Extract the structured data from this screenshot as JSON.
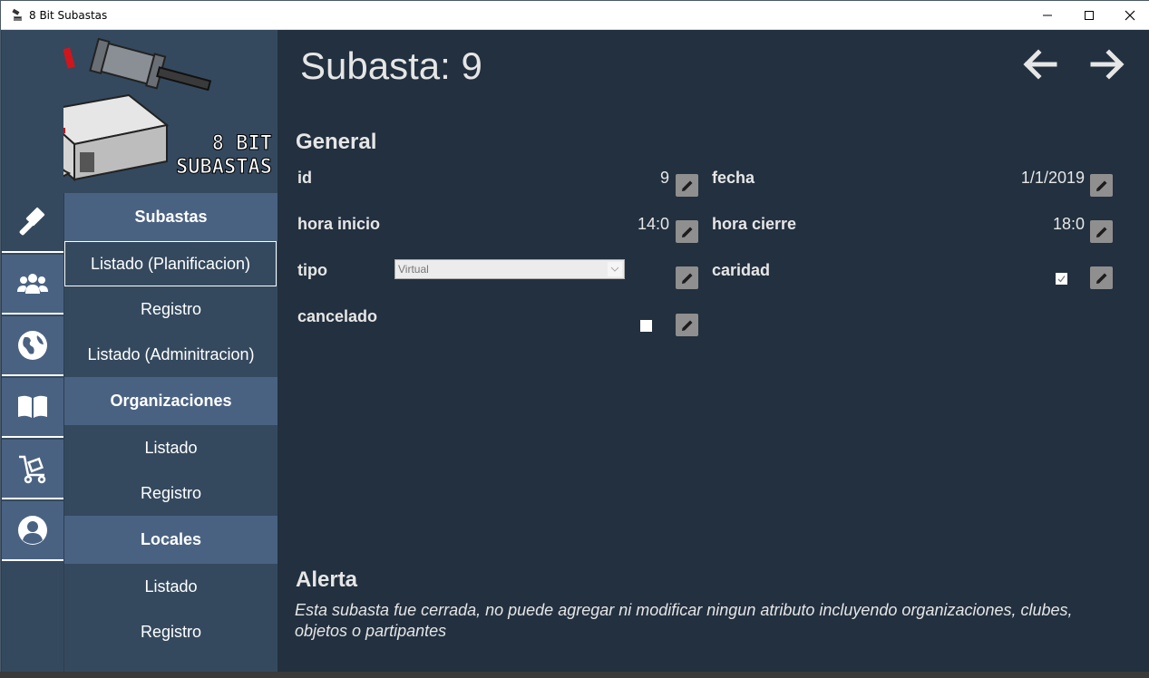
{
  "window": {
    "title": "8 Bit Subastas"
  },
  "logo": {
    "line1": "8 BIT",
    "line2": "SUBASTAS"
  },
  "nav_icons": [
    "gavel-icon",
    "users-icon",
    "globe-icon",
    "book-icon",
    "cart-icon",
    "user-circle-icon"
  ],
  "submenu": {
    "subastas_header": "Subastas",
    "subastas_items": [
      "Listado (Planificacion)",
      "Registro",
      "Listado (Adminitracion)"
    ],
    "organizaciones_header": "Organizaciones",
    "organizaciones_items": [
      "Listado",
      "Registro"
    ],
    "locales_header": "Locales",
    "locales_items": [
      "Listado",
      "Registro"
    ]
  },
  "main": {
    "page_title": "Subasta: 9",
    "general_title": "General",
    "fields": {
      "id_label": "id",
      "id_value": "9",
      "fecha_label": "fecha",
      "fecha_value": "1/1/2019",
      "hora_inicio_label": "hora inicio",
      "hora_inicio_value": "14:0",
      "hora_cierre_label": "hora cierre",
      "hora_cierre_value": "18:0",
      "tipo_label": "tipo",
      "tipo_value": "Virtual",
      "caridad_label": "caridad",
      "caridad_checked": true,
      "cancelado_label": "cancelado",
      "cancelado_checked": false
    },
    "alert_title": "Alerta",
    "alert_text": "Esta subasta fue cerrada, no puede agregar ni modificar ningun atributo incluyendo organizaciones, clubes, objetos o partipantes"
  },
  "colors": {
    "sidebar": "#34495e",
    "accent": "#4a6282",
    "main_bg": "#22303f"
  }
}
